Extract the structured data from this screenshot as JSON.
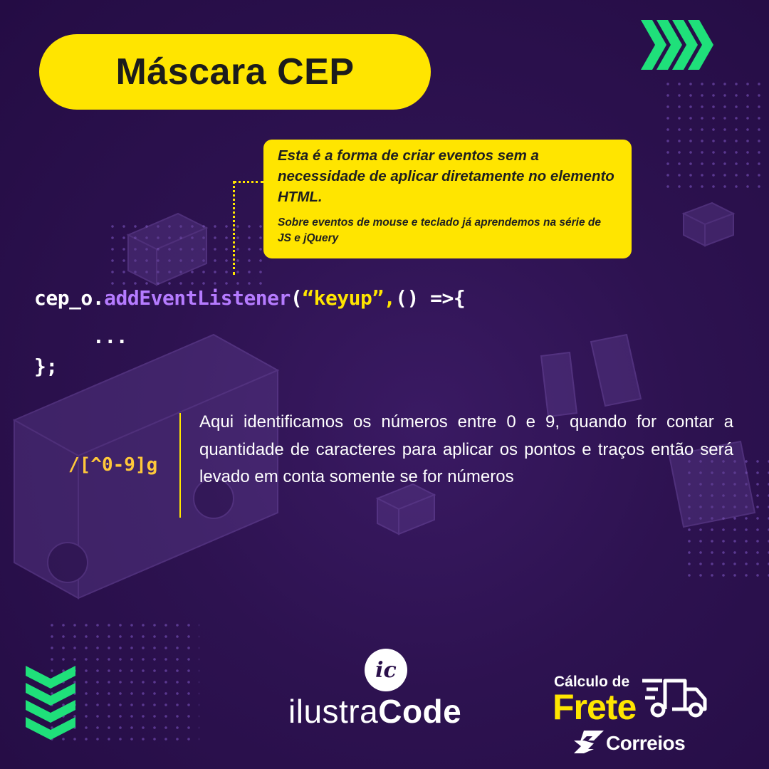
{
  "title": "Máscara CEP",
  "note": {
    "main": "Esta é a forma de criar eventos sem a necessidade de aplicar diretamente no elemento HTML.",
    "sub": "Sobre eventos de mouse e teclado já aprendemos na série de JS e jQuery"
  },
  "code": {
    "var": "cep_o.",
    "method": "addEventListener",
    "open_paren": "(",
    "string": "“keyup”,",
    "rest": "() =>{",
    "body": "...",
    "close": "};"
  },
  "regex": "/[^0-9]g",
  "description": "Aqui identificamos os números entre 0 e 9, quando for contar a quantidade de caracteres para aplicar os pontos e traços então será levado em conta somente se for números",
  "brand": {
    "ic": "ic",
    "word_light": "ilustra",
    "word_bold": "Code"
  },
  "frete": {
    "line1": "Cálculo de",
    "line2": "Frete",
    "correios": "Correios"
  },
  "colors": {
    "background": "#2a0f4a",
    "accent_yellow": "#ffe500",
    "accent_green": "#1fe07a",
    "method_purple": "#b57bff"
  },
  "icons": [
    "chevrons-right-icon",
    "chevrons-down-icon",
    "truck-icon",
    "correios-logo-icon"
  ]
}
